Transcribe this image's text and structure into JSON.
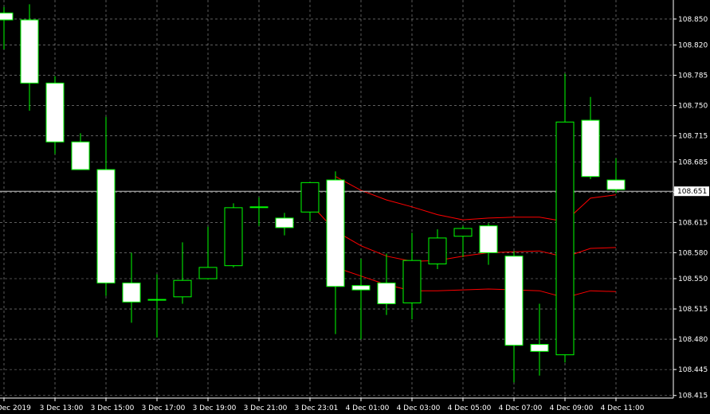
{
  "chart_data": {
    "type": "candlestick",
    "title": "",
    "xlabel": "",
    "ylabel": "",
    "ylim": [
      108.412,
      108.872
    ],
    "grid": true,
    "colors": {
      "background": "#000000",
      "grid": "#c8c8c8",
      "axis": "#ffffff",
      "text": "#ffffff",
      "bull_body": "#000000",
      "bear_body": "#ffffff",
      "candle_outline": "#00ff00",
      "wick": "#00ff00",
      "envelope": "#ff0000",
      "current_price_line": "#c8c8c8",
      "price_tag_bg": "#ffffff"
    },
    "y_ticks": [
      "108.850",
      "108.820",
      "108.785",
      "108.750",
      "108.715",
      "108.685",
      "108.650",
      "108.615",
      "108.580",
      "108.550",
      "108.515",
      "108.480",
      "108.445",
      "108.415"
    ],
    "x_ticks": [
      "3 Dec 2019",
      "3 Dec 13:00",
      "3 Dec 15:00",
      "3 Dec 17:00",
      "3 Dec 19:00",
      "3 Dec 21:00",
      "3 Dec 23:01",
      "4 Dec 01:00",
      "4 Dec 03:00",
      "4 Dec 05:00",
      "4 Dec 07:00",
      "4 Dec 09:00",
      "4 Dec 11:00"
    ],
    "current_price": "108.651",
    "candles": [
      {
        "open": 108.857,
        "high": 108.864,
        "low": 108.815,
        "close": 108.849
      },
      {
        "open": 108.849,
        "high": 108.867,
        "low": 108.744,
        "close": 108.776
      },
      {
        "open": 108.776,
        "high": 108.784,
        "low": 108.694,
        "close": 108.708
      },
      {
        "open": 108.708,
        "high": 108.718,
        "low": 108.68,
        "close": 108.676
      },
      {
        "open": 108.676,
        "high": 108.737,
        "low": 108.53,
        "close": 108.545
      },
      {
        "open": 108.545,
        "high": 108.58,
        "low": 108.499,
        "close": 108.523
      },
      {
        "open": 108.526,
        "high": 108.555,
        "low": 108.482,
        "close": 108.526
      },
      {
        "open": 108.529,
        "high": 108.592,
        "low": 108.521,
        "close": 108.548
      },
      {
        "open": 108.55,
        "high": 108.61,
        "low": 108.549,
        "close": 108.563
      },
      {
        "open": 108.565,
        "high": 108.637,
        "low": 108.563,
        "close": 108.632
      },
      {
        "open": 108.633,
        "high": 108.644,
        "low": 108.611,
        "close": 108.633
      },
      {
        "open": 108.62,
        "high": 108.626,
        "low": 108.6,
        "close": 108.609
      },
      {
        "open": 108.627,
        "high": 108.658,
        "low": 108.617,
        "close": 108.661
      },
      {
        "open": 108.664,
        "high": 108.674,
        "low": 108.486,
        "close": 108.541
      },
      {
        "open": 108.542,
        "high": 108.573,
        "low": 108.48,
        "close": 108.537
      },
      {
        "open": 108.545,
        "high": 108.579,
        "low": 108.508,
        "close": 108.521
      },
      {
        "open": 108.522,
        "high": 108.603,
        "low": 108.503,
        "close": 108.571
      },
      {
        "open": 108.567,
        "high": 108.607,
        "low": 108.561,
        "close": 108.597
      },
      {
        "open": 108.599,
        "high": 108.611,
        "low": 108.575,
        "close": 108.608
      },
      {
        "open": 108.611,
        "high": 108.614,
        "low": 108.566,
        "close": 108.58
      },
      {
        "open": 108.576,
        "high": 108.582,
        "low": 108.43,
        "close": 108.473
      },
      {
        "open": 108.474,
        "high": 108.521,
        "low": 108.438,
        "close": 108.466
      },
      {
        "open": 108.462,
        "high": 108.787,
        "low": 108.453,
        "close": 108.731
      },
      {
        "open": 108.733,
        "high": 108.76,
        "low": 108.665,
        "close": 108.668
      },
      {
        "open": 108.664,
        "high": 108.689,
        "low": 108.649,
        "close": 108.653
      }
    ],
    "envelopes": [
      {
        "name": "",
        "values": [
          null,
          null,
          null,
          null,
          null,
          null,
          null,
          null,
          null,
          null,
          null,
          null,
          null,
          108.668,
          108.652,
          108.641,
          108.633,
          108.624,
          108.618,
          108.62,
          108.621,
          108.621,
          108.616,
          108.643,
          108.647
        ]
      },
      {
        "name": "",
        "values": [
          null,
          null,
          null,
          null,
          null,
          null,
          null,
          null,
          null,
          null,
          null,
          null,
          108.637,
          108.605,
          108.588,
          108.576,
          108.57,
          108.571,
          108.576,
          108.58,
          108.581,
          108.582,
          108.575,
          108.585,
          108.586
        ]
      },
      {
        "name": "",
        "values": [
          null,
          null,
          null,
          null,
          null,
          null,
          null,
          null,
          null,
          null,
          null,
          null,
          null,
          108.563,
          108.553,
          108.543,
          108.536,
          108.536,
          108.537,
          108.538,
          108.537,
          108.536,
          108.528,
          108.536,
          108.535
        ]
      }
    ]
  }
}
